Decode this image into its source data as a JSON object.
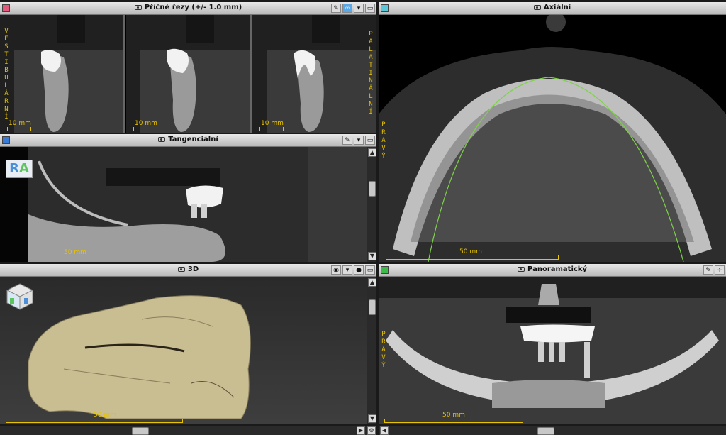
{
  "panes": {
    "cross": {
      "title": "Příčné řezy (+/- 1.0 mm)",
      "swatch": "#e35a7a",
      "scale": "10 mm",
      "left_label": "VESTIBULÁRNÍ",
      "right_label": "PALATINÁLNÍ"
    },
    "axial": {
      "title": "Axiální",
      "swatch": "#5ac8d8",
      "scale": "50 mm",
      "side_label": "PRAVÝ"
    },
    "tangential": {
      "title": "Tangenciální",
      "swatch": "#3a7bd5",
      "scale": "50 mm",
      "ra_r": "R",
      "ra_a": "A"
    },
    "threed": {
      "title": "3D",
      "scale": "50 mm"
    },
    "pano": {
      "title": "Panoramatický",
      "swatch": "#3dbb4a",
      "scale": "50 mm",
      "side_label": "PRAVÝ"
    }
  },
  "icons": [
    "camera-icon",
    "link-icon",
    "dropdown-icon",
    "maximize-icon",
    "eye-icon",
    "settings-gear-icon"
  ],
  "colors": {
    "label_yellow": "#e6c200",
    "arch_green": "#7fd14a",
    "model_beige": "#c9bd92"
  }
}
